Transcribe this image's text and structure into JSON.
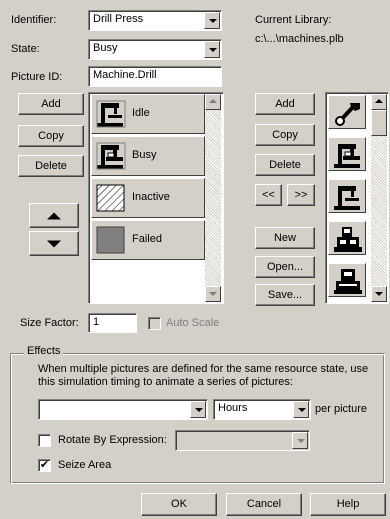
{
  "identifier": {
    "label": "Identifier:",
    "value": "Drill Press"
  },
  "state": {
    "label": "State:",
    "value": "Busy"
  },
  "picture_id": {
    "label": "Picture ID:",
    "value": "Machine.Drill"
  },
  "current_library": {
    "label": "Current Library:",
    "path": "c:\\...\\machines.plb"
  },
  "left_buttons": {
    "add": "Add",
    "copy": "Copy",
    "delete": "Delete"
  },
  "pictures": [
    {
      "label": "Idle",
      "icon": "drill-press-icon"
    },
    {
      "label": "Busy",
      "icon": "drill-press-busy-icon"
    },
    {
      "label": "Inactive",
      "icon": "hatched-box-icon"
    },
    {
      "label": "Failed",
      "icon": "gray-box-icon"
    }
  ],
  "library_buttons": {
    "add": "Add",
    "copy": "Copy",
    "delete": "Delete",
    "prev": "<<",
    "next": ">>",
    "new": "New",
    "open": "Open...",
    "save": "Save..."
  },
  "library_pictures": [
    "wrench-icon",
    "drill-press-busy-icon",
    "drill-press-icon",
    "machine-tool-icon",
    "press-machine-icon"
  ],
  "size_factor": {
    "label": "Size Factor:",
    "value": "1"
  },
  "auto_scale": {
    "label": "Auto Scale",
    "checked": false
  },
  "effects": {
    "title": "Effects",
    "description": "When multiple pictures are defined for the same resource state, use this simulation timing to animate a series of pictures:",
    "timing_value": "",
    "units": "Hours",
    "per_picture": "per picture",
    "rotate": {
      "label": "Rotate By Expression:",
      "checked": false,
      "value": ""
    },
    "seize": {
      "label": "Seize Area",
      "checked": true
    }
  },
  "dialog_buttons": {
    "ok": "OK",
    "cancel": "Cancel",
    "help": "Help"
  }
}
